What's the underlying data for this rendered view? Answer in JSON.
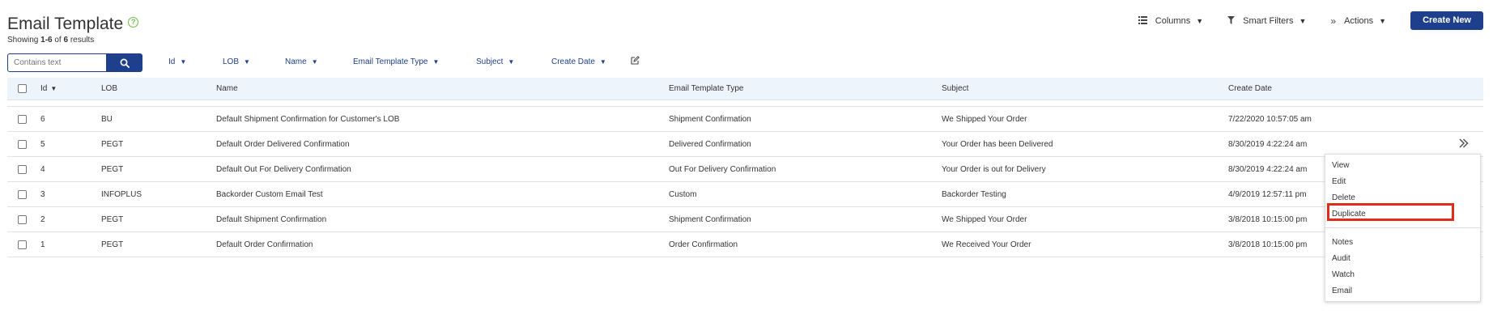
{
  "page": {
    "title": "Email Template",
    "results_prefix": "Showing ",
    "results_range": "1-6",
    "results_of": " of ",
    "results_total": "6",
    "results_suffix": " results"
  },
  "toolbar": {
    "columns_label": "Columns",
    "smart_filters_label": "Smart Filters",
    "actions_label": "Actions",
    "create_label": "Create New"
  },
  "search": {
    "placeholder": "Contains text"
  },
  "filters": {
    "id": "Id",
    "lob": "LOB",
    "name": "Name",
    "type": "Email Template Type",
    "subject": "Subject",
    "create_date": "Create Date"
  },
  "columns": {
    "id": "Id",
    "lob": "LOB",
    "name": "Name",
    "type": "Email Template Type",
    "subject": "Subject",
    "create_date": "Create Date"
  },
  "rows": [
    {
      "id": "6",
      "lob": "BU",
      "name": "Default Shipment Confirmation for Customer's LOB",
      "type": "Shipment Confirmation",
      "subject": "We Shipped Your Order",
      "date": "7/22/2020 10:57:05 am"
    },
    {
      "id": "5",
      "lob": "PEGT",
      "name": "Default Order Delivered Confirmation",
      "type": "Delivered Confirmation",
      "subject": "Your Order has been Delivered",
      "date": "8/30/2019 4:22:24 am"
    },
    {
      "id": "4",
      "lob": "PEGT",
      "name": "Default Out For Delivery Confirmation",
      "type": "Out For Delivery Confirmation",
      "subject": "Your Order is out for Delivery",
      "date": "8/30/2019 4:22:24 am"
    },
    {
      "id": "3",
      "lob": "INFOPLUS",
      "name": "Backorder Custom Email Test",
      "type": "Custom",
      "subject": "Backorder Testing",
      "date": "4/9/2019 12:57:11 pm"
    },
    {
      "id": "2",
      "lob": "PEGT",
      "name": "Default Shipment Confirmation",
      "type": "Shipment Confirmation",
      "subject": "We Shipped Your Order",
      "date": "3/8/2018 10:15:00 pm"
    },
    {
      "id": "1",
      "lob": "PEGT",
      "name": "Default Order Confirmation",
      "type": "Order Confirmation",
      "subject": "We Received Your Order",
      "date": "3/8/2018 10:15:00 pm"
    }
  ],
  "row_menu": {
    "view": "View",
    "edit": "Edit",
    "delete": "Delete",
    "duplicate": "Duplicate",
    "notes": "Notes",
    "audit": "Audit",
    "watch": "Watch",
    "email": "Email"
  },
  "colors": {
    "primary": "#1d3f8c",
    "help": "#6cbb45",
    "highlight": "#e12b1b",
    "header_bg": "#eef4fb"
  }
}
